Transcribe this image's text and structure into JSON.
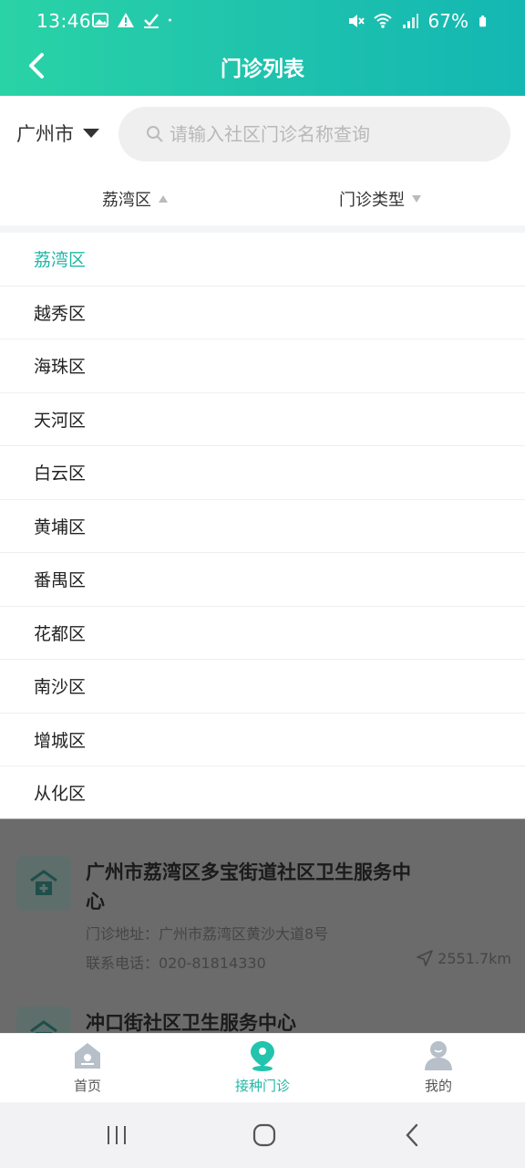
{
  "status_bar": {
    "time": "13:46",
    "battery": "67%",
    "left_icons": [
      "image-icon",
      "warning-icon",
      "check-icon",
      "dot-icon"
    ],
    "right_icons": [
      "mute-icon",
      "wifi-icon",
      "signal-icon",
      "battery-icon"
    ]
  },
  "header": {
    "title": "门诊列表"
  },
  "search": {
    "city": "广州市",
    "placeholder": "请输入社区门诊名称查询"
  },
  "filters": {
    "district_label": "荔湾区",
    "type_label": "门诊类型"
  },
  "districts": [
    "荔湾区",
    "越秀区",
    "海珠区",
    "天河区",
    "白云区",
    "黄埔区",
    "番禺区",
    "花都区",
    "南沙区",
    "增城区",
    "从化区"
  ],
  "selected_district": "荔湾区",
  "clinics": [
    {
      "name": "广州市荔湾区多宝街道社区卫生服务中心",
      "address": "门诊地址：广州市荔湾区黄沙大道8号",
      "phone": "联系电话：020-81814330",
      "distance": "2551.7km"
    },
    {
      "name": "冲口街社区卫生服务中心"
    }
  ],
  "tab_bar": {
    "items": [
      {
        "label": "首页",
        "icon": "home-icon"
      },
      {
        "label": "接种门诊",
        "icon": "location-pin-icon"
      },
      {
        "label": "我的",
        "icon": "user-icon"
      }
    ],
    "active_index": 1
  },
  "colors": {
    "primary": "#1fb7a7",
    "header_start": "#2ad3a6",
    "header_end": "#14b7b2",
    "overlay": "#6b6b6b"
  }
}
